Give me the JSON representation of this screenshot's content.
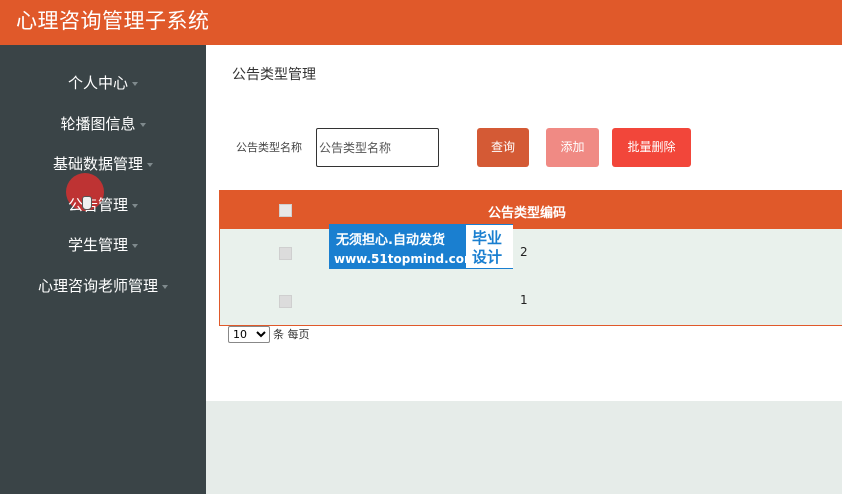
{
  "header": {
    "title": "心理咨询管理子系统"
  },
  "sidebar": {
    "items": [
      {
        "label": "个人中心"
      },
      {
        "label": "轮播图信息"
      },
      {
        "label": "基础数据管理"
      },
      {
        "label": "公告管理"
      },
      {
        "label": "学生管理"
      },
      {
        "label": "心理咨询老师管理"
      }
    ]
  },
  "main": {
    "page_title": "公告类型管理",
    "search": {
      "label": "公告类型名称",
      "placeholder": "公告类型名称",
      "value": ""
    },
    "buttons": {
      "query": "查询",
      "add": "添加",
      "batch_delete": "批量删除"
    },
    "table": {
      "column_header": "公告类型编码",
      "rows": [
        {
          "code": "2"
        },
        {
          "code": "1"
        }
      ]
    },
    "pager": {
      "page_size": "10",
      "label": "条 每页"
    }
  },
  "watermark": {
    "line1": "无须担心.自动发货",
    "line2": "www.51topmind.com",
    "box_line1": "毕业",
    "box_line2": "设计"
  },
  "colors": {
    "accent": "#e0592a",
    "sidebar": "#3a4447",
    "table_bg": "#e9f1ec"
  }
}
